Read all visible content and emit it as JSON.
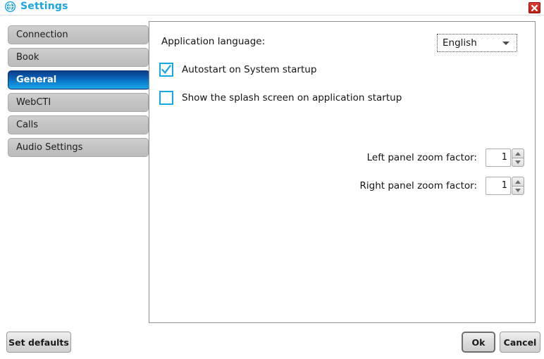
{
  "window": {
    "title": "Settings",
    "icon": "globe-icon",
    "close_icon": "close-icon",
    "title_color": "#1ba6e0",
    "close_color": "#c21d14"
  },
  "sidebar": {
    "items": [
      {
        "label": "Connection",
        "active": false
      },
      {
        "label": "Book",
        "active": false
      },
      {
        "label": "General",
        "active": true
      },
      {
        "label": "WebCTI",
        "active": false
      },
      {
        "label": "Calls",
        "active": false
      },
      {
        "label": "Audio Settings",
        "active": false
      }
    ],
    "active_color": "#0b7fd0"
  },
  "main": {
    "language": {
      "label": "Application language:",
      "value": "English",
      "options": [
        "English"
      ],
      "arrow_icon": "chevron-down-icon"
    },
    "autostart": {
      "label": "Autostart on System startup",
      "checked": true,
      "check_icon": "checkmark-icon",
      "accent": "#17a8e3"
    },
    "splash": {
      "label": "Show the splash screen on application startup",
      "checked": false,
      "accent": "#17a8e3"
    },
    "left_zoom": {
      "label": "Left panel zoom factor:",
      "value": "1",
      "up_icon": "triangle-up-icon",
      "down_icon": "triangle-down-icon"
    },
    "right_zoom": {
      "label": "Right panel zoom factor:",
      "value": "1",
      "up_icon": "triangle-up-icon",
      "down_icon": "triangle-down-icon"
    }
  },
  "footer": {
    "set_defaults": "Set defaults",
    "ok": "Ok",
    "cancel": "Cancel"
  }
}
